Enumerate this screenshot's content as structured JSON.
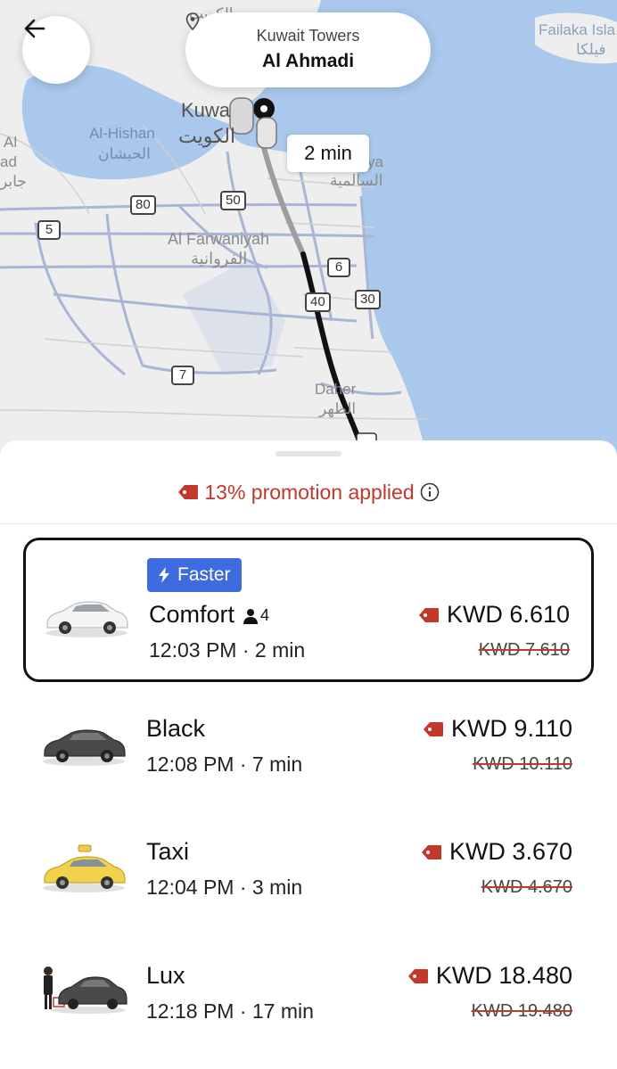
{
  "map": {
    "labels": {
      "kuwait_en": "Kuwa",
      "kuwait_ar": "الكويت",
      "hishan_en": "Al-Hishan",
      "hishan_ar": "الحيشان",
      "farwaniyah_en": "Al Farwaniyah",
      "farwaniyah_ar": "الفروانية",
      "salmiya_en": "ya",
      "salmiya_ar": "السالمية",
      "dahar_en": "Daher",
      "dahar_ar": "الظهر",
      "failaka_en": "Failaka Isla",
      "failaka_ar": "فيلكا",
      "left_a": "Al",
      "left_b": "ad",
      "left_c": "جابر",
      "top_ar": "الكويت"
    },
    "shields": {
      "r80": "80",
      "r50": "50",
      "r5": "5",
      "r6": "6",
      "r40": "40",
      "r30": "30",
      "r7": "7"
    },
    "eta": "2 min"
  },
  "header": {
    "from": "Kuwait Towers",
    "to": "Al Ahmadi"
  },
  "promotion": {
    "text": "13% promotion applied",
    "color": "#c0392b"
  },
  "rides": [
    {
      "badge": "Faster",
      "name": "Comfort",
      "capacity": "4",
      "time": "12:03 PM · 2 min",
      "price": "KWD 6.610",
      "old_price": "KWD 7.610",
      "selected": true
    },
    {
      "name": "Black",
      "time": "12:08 PM · 7 min",
      "price": "KWD 9.110",
      "old_price": "KWD 10.110"
    },
    {
      "name": "Taxi",
      "time": "12:04 PM · 3 min",
      "price": "KWD 3.670",
      "old_price": "KWD 4.670"
    },
    {
      "name": "Lux",
      "time": "12:18 PM · 17 min",
      "price": "KWD 18.480",
      "old_price": "KWD 19.480"
    }
  ]
}
